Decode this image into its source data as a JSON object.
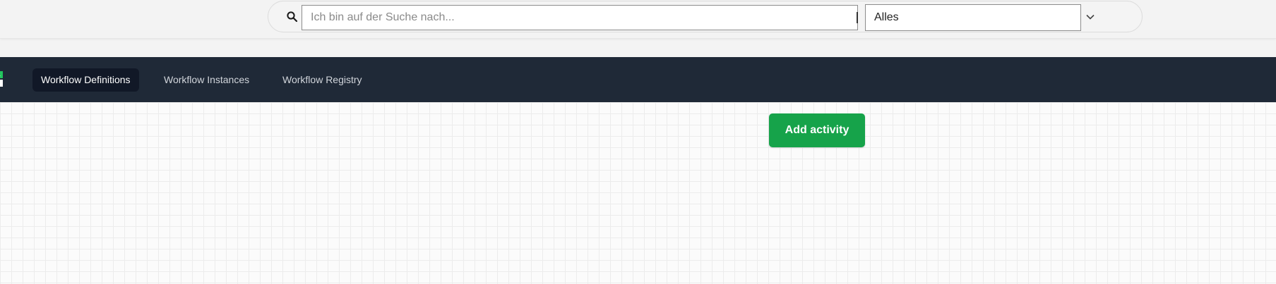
{
  "search": {
    "placeholder": "Ich bin auf der Suche nach...",
    "value": "",
    "scope_selected": "Alles"
  },
  "nav": {
    "items": [
      {
        "label": "Workflow Definitions",
        "active": true
      },
      {
        "label": "Workflow Instances",
        "active": false
      },
      {
        "label": "Workflow Registry",
        "active": false
      }
    ]
  },
  "designer": {
    "add_activity_label": "Add activity"
  },
  "colors": {
    "navbar_bg": "#1f2937",
    "active_tab_bg": "#111827",
    "accent_green": "#16a34a",
    "logo_green": "#22c55e"
  },
  "icons": {
    "search": "search-icon",
    "dropdown": "chevron-down-icon",
    "logo": "logo-icon"
  }
}
